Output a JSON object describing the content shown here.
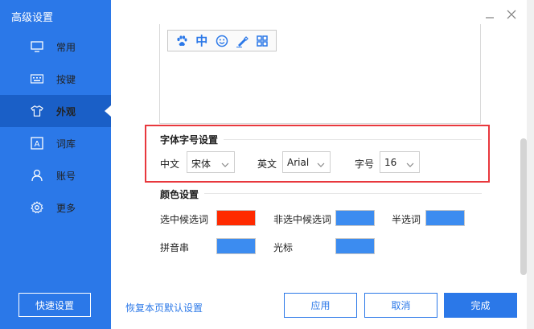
{
  "sidebar": {
    "title": "高级设置",
    "items": [
      {
        "label": "常用",
        "icon": "monitor-icon"
      },
      {
        "label": "按键",
        "icon": "keyboard-icon"
      },
      {
        "label": "外观",
        "icon": "shirt-icon",
        "active": true
      },
      {
        "label": "词库",
        "icon": "dictionary-icon"
      },
      {
        "label": "账号",
        "icon": "user-icon"
      },
      {
        "label": "更多",
        "icon": "gear-icon"
      }
    ],
    "quick_button": "快速设置"
  },
  "toolbar": {
    "icons": [
      "paw-icon",
      "chinese-mode-icon",
      "emoji-icon",
      "brush-icon",
      "grid-icon"
    ],
    "mode_char": "中"
  },
  "font_section": {
    "title": "字体字号设置",
    "chinese_label": "中文",
    "chinese_value": "宋体",
    "english_label": "英文",
    "english_value": "Arial",
    "size_label": "字号",
    "size_value": "16"
  },
  "color_section": {
    "title": "颜色设置",
    "items": [
      {
        "label": "选中候选词",
        "color": "#ff2a00"
      },
      {
        "label": "非选中候选词",
        "color": "#3c8cf0"
      },
      {
        "label": "半选词",
        "color": "#3c8cf0"
      },
      {
        "label": "拼音串",
        "color": "#3c8cf0"
      },
      {
        "label": "光标",
        "color": "#3c8cf0"
      }
    ]
  },
  "footer": {
    "restore_link": "恢复本页默认设置",
    "apply": "应用",
    "cancel": "取消",
    "done": "完成"
  },
  "colors": {
    "accent": "#2b78e8",
    "highlight_border": "#e8383d"
  }
}
